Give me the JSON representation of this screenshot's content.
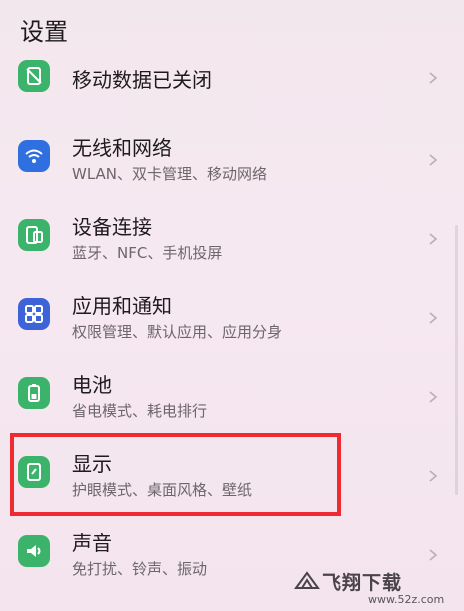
{
  "header": {
    "title": "设置"
  },
  "items": [
    {
      "name": "mobile-data",
      "label": "移动数据已关闭",
      "sub": "",
      "icon": "mobile-data-off-icon",
      "color": "#3bb36a"
    },
    {
      "name": "wireless",
      "label": "无线和网络",
      "sub": "WLAN、双卡管理、移动网络",
      "icon": "wifi-icon",
      "color": "#2f6fe0"
    },
    {
      "name": "device-connection",
      "label": "设备连接",
      "sub": "蓝牙、NFC、手机投屏",
      "icon": "device-connection-icon",
      "color": "#3bb36a"
    },
    {
      "name": "apps-notifications",
      "label": "应用和通知",
      "sub": "权限管理、默认应用、应用分身",
      "icon": "apps-grid-icon",
      "color": "#3c64d8"
    },
    {
      "name": "battery",
      "label": "电池",
      "sub": "省电模式、耗电排行",
      "icon": "battery-icon",
      "color": "#3bb36a"
    },
    {
      "name": "display",
      "label": "显示",
      "sub": "护眼模式、桌面风格、壁纸",
      "icon": "display-icon",
      "color": "#3bb36a"
    },
    {
      "name": "sound",
      "label": "声音",
      "sub": "免打扰、铃声、振动",
      "icon": "speaker-icon",
      "color": "#3bb36a"
    }
  ],
  "watermark": {
    "title": "飞翔下载",
    "url": "www.52z.com"
  }
}
